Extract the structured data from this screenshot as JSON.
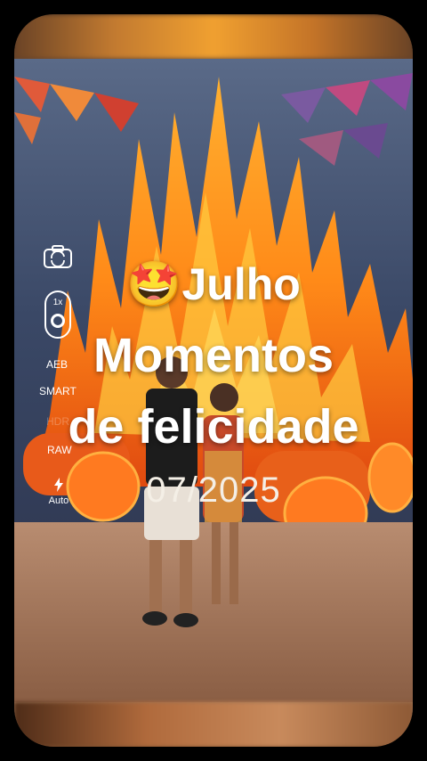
{
  "camera_ui": {
    "zoom_label": "1x",
    "aeb_label": "AEB",
    "smart_label": "SMART",
    "hdr_label": "HDR",
    "raw_label": "RAW",
    "flash_label": "Auto"
  },
  "overlay": {
    "emoji": "🤩",
    "line1": "Julho",
    "line2": "Momentos",
    "line3": "de felicidade",
    "date": "07/2025"
  }
}
